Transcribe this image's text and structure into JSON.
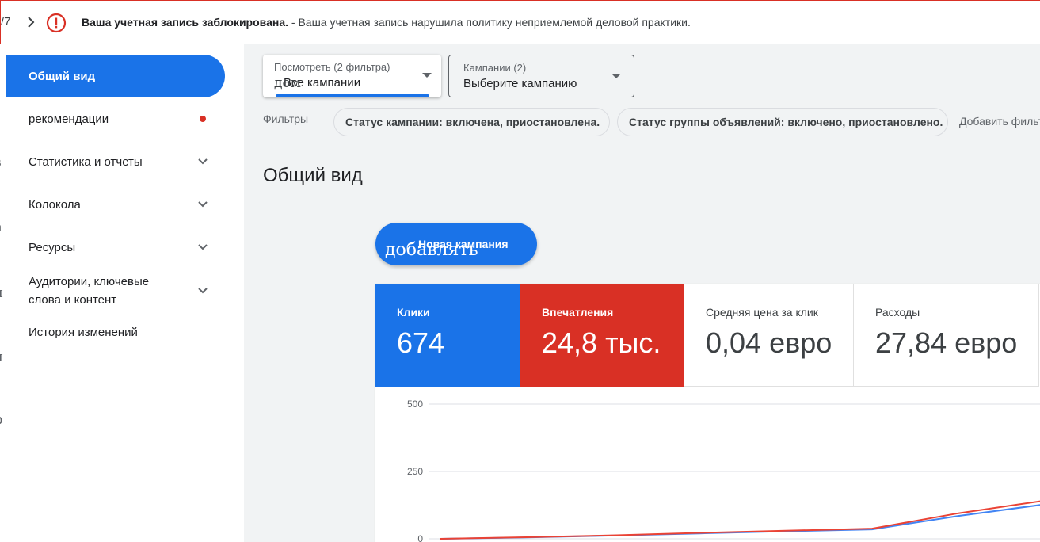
{
  "banner": {
    "counter": "/7",
    "title": "Ваша учетная запись заблокирована.",
    "message": " - Ваша учетная запись нарушила политику неприемлемой деловой практики.",
    "icon": "error-circle-icon",
    "border_color": "#d93025"
  },
  "edge_glyphs": [
    "з",
    "а",
    "и",
    "и",
    "р"
  ],
  "sidebar": {
    "items": [
      {
        "label": "Общий вид",
        "active": true
      },
      {
        "label": "рекомендации",
        "badge": "dot"
      },
      {
        "label": "Статистика и отчеты",
        "expandable": true
      },
      {
        "label": "Колокола",
        "expandable": true
      },
      {
        "label": "Ресурсы",
        "expandable": true
      },
      {
        "label": "Аудитории, ключевые слова и контент",
        "expandable": true
      },
      {
        "label": "История изменений"
      }
    ]
  },
  "toolbar": {
    "view": {
      "label": "Посмотреть (2 фильтра)",
      "value": "Все кампании",
      "overlay": "дом"
    },
    "campaigns": {
      "label": "Кампании (2)",
      "value": "Выберите кампанию"
    }
  },
  "filters": {
    "label": "Фильтры",
    "chips": [
      "Статус кампании: включена, приостановлена.",
      "Статус группы объявлений: включено, приостановлено."
    ],
    "add": "Добавить фильтр"
  },
  "page_title": "Общий вид",
  "new_campaign": {
    "label": "Новая кампания",
    "overlay": "добавлять"
  },
  "metrics": [
    {
      "label": "Клики",
      "value": "674",
      "color": "#1a73e8"
    },
    {
      "label": "Впечатления",
      "value": "24,8 тыс.",
      "color": "#d93025"
    },
    {
      "label": "Средняя цена за клик",
      "value": "0,04 евро"
    },
    {
      "label": "Расходы",
      "value": "27,84 евро"
    }
  ],
  "chart_data": {
    "type": "line",
    "y_ticks": [
      "500",
      "250",
      "0"
    ],
    "ylim": [
      0,
      500
    ],
    "series": [
      {
        "color": "#4285f4",
        "values": [
          0,
          5,
          12,
          20,
          28,
          35,
          85,
          128
        ]
      },
      {
        "color": "#ea4335",
        "values": [
          0,
          6,
          13,
          22,
          30,
          38,
          95,
          142
        ]
      }
    ]
  }
}
